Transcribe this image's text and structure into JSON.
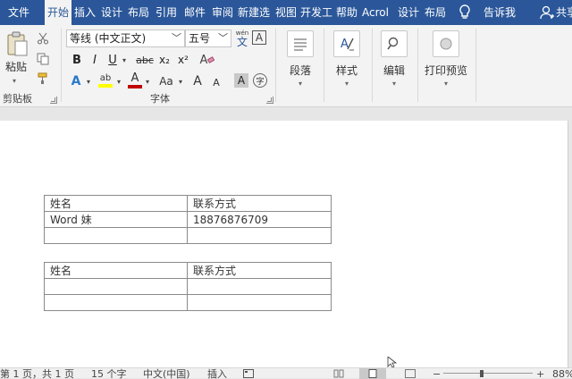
{
  "tabs": [
    {
      "label": "文件"
    },
    {
      "label": "开始"
    },
    {
      "label": "插入"
    },
    {
      "label": "设计"
    },
    {
      "label": "布局"
    },
    {
      "label": "引用"
    },
    {
      "label": "邮件"
    },
    {
      "label": "审阅"
    },
    {
      "label": "新建选"
    },
    {
      "label": "视图"
    },
    {
      "label": "开发工"
    },
    {
      "label": "帮助"
    },
    {
      "label": "Acrol"
    },
    {
      "label": "设计"
    },
    {
      "label": "布局"
    }
  ],
  "tell_me": "告诉我",
  "share": "共享",
  "ribbon": {
    "clipboard": {
      "paste_label": "粘贴",
      "group_label": "剪贴板"
    },
    "font": {
      "font_name": "等线 (中文正文)",
      "font_size": "五号",
      "phonetic_glyph": "wén",
      "phonetic_char": "文",
      "border_char": "A",
      "bold": "B",
      "italic": "I",
      "underline": "U",
      "strike": "abc",
      "subscript": "x₂",
      "superscript": "x²",
      "clear": "A",
      "effects": "A",
      "highlight": "ab",
      "font_color": "A",
      "change_case": "Aa",
      "grow": "A",
      "shrink": "A",
      "shading": "A",
      "enclose": "字",
      "group_label": "字体"
    },
    "paragraph": {
      "label": "段落"
    },
    "styles": {
      "label": "样式"
    },
    "editing": {
      "label": "编辑"
    },
    "print_preview": {
      "label": "打印预览"
    }
  },
  "tables": [
    {
      "rows": [
        [
          "姓名",
          "联系方式"
        ],
        [
          "Word 妹",
          "18876876709"
        ],
        [
          "",
          ""
        ]
      ]
    },
    {
      "rows": [
        [
          "姓名",
          "联系方式"
        ],
        [
          "",
          ""
        ],
        [
          "",
          ""
        ]
      ]
    }
  ],
  "status": {
    "page": "第 1 页，共 1 页",
    "words": "15 个字",
    "language": "中文(中国)",
    "mode": "插入",
    "zoom": "88%"
  },
  "colors": {
    "accent": "#2b579a",
    "highlight": "#ffff00",
    "font_color": "#c00000"
  }
}
